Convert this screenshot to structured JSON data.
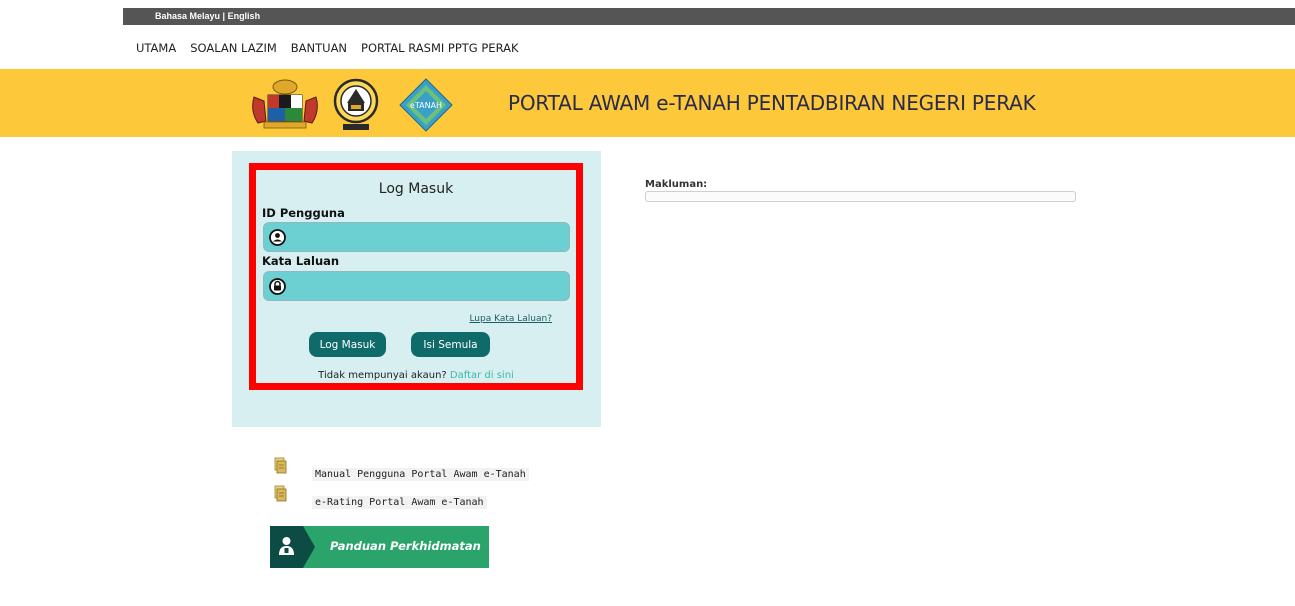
{
  "topbar": {
    "lang_malay": "Bahasa Melayu",
    "separator": " | ",
    "lang_english": "English"
  },
  "nav": {
    "items": [
      "UTAMA",
      "SOALAN LAZIM",
      "BANTUAN",
      "PORTAL RASMI PPTG PERAK"
    ]
  },
  "banner": {
    "title": "PORTAL AWAM e-TANAH PENTADBIRAN NEGERI PERAK",
    "logo3_text": "eTANAH",
    "bg_color": "#fdc93a"
  },
  "login": {
    "title": "Log Masuk",
    "user_label": "ID Pengguna",
    "pass_label": "Kata Laluan",
    "user_value": "",
    "pass_value": "",
    "forgot_link": "Lupa Kata Laluan?",
    "login_button": "Log Masuk",
    "reset_button": "Isi Semula",
    "no_account_text": "Tidak mempunyai akaun?",
    "register_link": "Daftar di sini",
    "user_icon": "user-circle-icon",
    "lock_icon": "lock-circle-icon",
    "highlight_color": "#ff0000"
  },
  "notice": {
    "label": "Makluman:",
    "content": ""
  },
  "docs": {
    "items": [
      "Manual Pengguna Portal Awam e-Tanah",
      "e-Rating Portal Awam e-Tanah"
    ],
    "icon": "document-stack-icon"
  },
  "panduan": {
    "label": "Panduan Perkhidmatan",
    "icon": "person-icon"
  }
}
